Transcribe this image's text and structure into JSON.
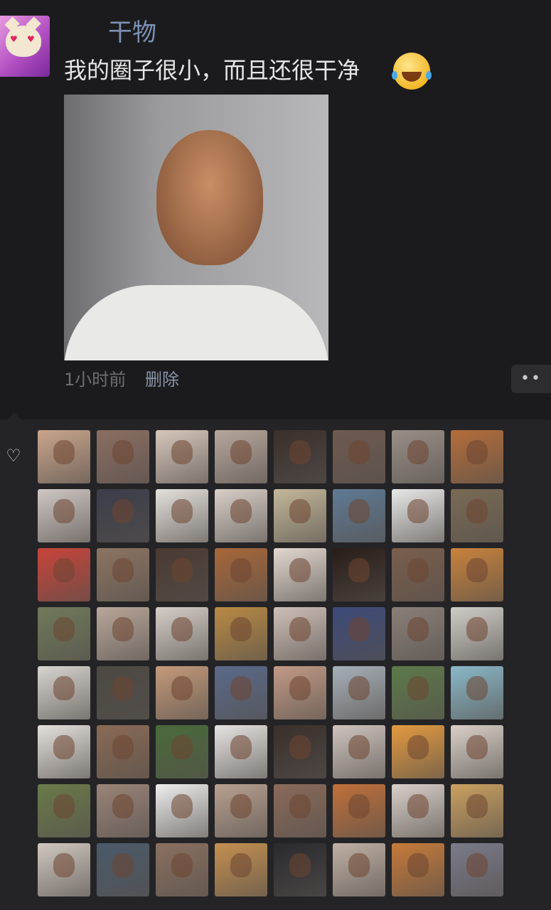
{
  "post": {
    "author": "干物",
    "text": "我的圈子很小，而且还很干净",
    "emoji": "laughing-tears-emoji",
    "time": "1小时前",
    "delete_label": "删除",
    "more_label": "••"
  },
  "likes": {
    "icon": "heart-icon",
    "avatar_colors": [
      "#caa58c",
      "#8b6e62",
      "#d7c7bb",
      "#b7a79c",
      "#3a302c",
      "#6e5a50",
      "#9a8f88",
      "#b56d3a",
      "#cfc7c4",
      "#3b3d4a",
      "#e4e0dc",
      "#d9cfc8",
      "#c4b79a",
      "#5f7a95",
      "#e8e8e8",
      "#7a6a55",
      "#c8443a",
      "#8c7462",
      "#4a3a32",
      "#a8673a",
      "#e2d8d0",
      "#2a1d18",
      "#7a5e4c",
      "#c9823c",
      "#6f7a5a",
      "#b9a79a",
      "#d6cfc8",
      "#b98a44",
      "#cfc0b8",
      "#3d4a7a",
      "#8a8078",
      "#d0cdc8",
      "#d8d4d0",
      "#4c4844",
      "#c49a7a",
      "#5a6a8a",
      "#c29a86",
      "#a7b0b8",
      "#5d7a4a",
      "#8ab8c8",
      "#e4e0dc",
      "#8a6a55",
      "#4a6a3a",
      "#e6e4e2",
      "#3a302c",
      "#cfc4bf",
      "#e39a40",
      "#d8d0c8",
      "#6a7a4a",
      "#9a8478",
      "#eeeeee",
      "#b8a090",
      "#8a6a5a",
      "#c0703a",
      "#d8cfc8",
      "#caa060",
      "#d0c8c0",
      "#4a5a6a",
      "#8a7060",
      "#c49050",
      "#2a2a2e",
      "#c0b0a4",
      "#c67a3a",
      "#7a7a8a"
    ]
  }
}
